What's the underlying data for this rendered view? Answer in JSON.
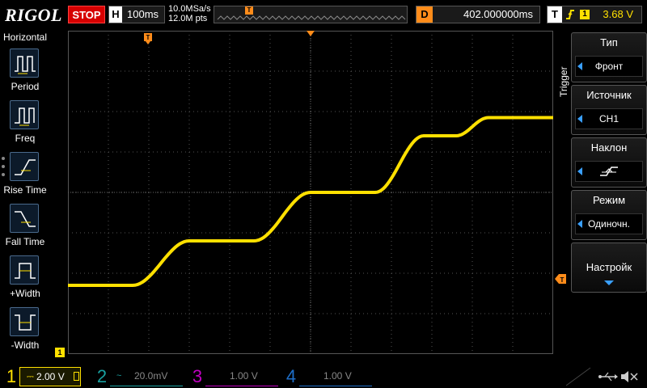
{
  "header": {
    "logo": "RIGOL",
    "run_state": "STOP",
    "horizontal_label": "H",
    "timebase": "100ms",
    "sample_rate": "10.0MSa/s",
    "memory_depth": "12.0M pts",
    "trigger_marker": "T",
    "delay_label": "D",
    "delay_value": "402.000000ms",
    "trigger_label": "T",
    "trigger_source_badge": "1",
    "trigger_level": "3.68 V"
  },
  "left_menu": {
    "title": "Horizontal",
    "items": [
      {
        "label": "Period",
        "icon": "period-icon"
      },
      {
        "label": "Freq",
        "icon": "frequency-icon"
      },
      {
        "label": "Rise Time",
        "icon": "rise-time-icon"
      },
      {
        "label": "Fall Time",
        "icon": "fall-time-icon"
      },
      {
        "label": "+Width",
        "icon": "positive-width-icon"
      },
      {
        "label": "-Width",
        "icon": "negative-width-icon"
      }
    ]
  },
  "right_menu": {
    "title": "Trigger",
    "buttons": [
      {
        "heading": "Тип",
        "value": "Фронт"
      },
      {
        "heading": "Источник",
        "value": "CH1"
      },
      {
        "heading": "Наклон",
        "value": "rising-edge-icon"
      },
      {
        "heading": "Режим",
        "value": "Одиночн."
      },
      {
        "heading": "Настройк"
      }
    ]
  },
  "screen": {
    "trigger_position_marker": "T",
    "ch1_ground_marker": "1",
    "trace_color": "#ffe000"
  },
  "channels": [
    {
      "number": "1",
      "coupling": "⎓",
      "scale": "2.00 V",
      "color": "#ffe000",
      "active": true
    },
    {
      "number": "2",
      "coupling": "~",
      "scale": "20.0mV",
      "color": "#19a0a0",
      "active": false
    },
    {
      "number": "3",
      "coupling": "",
      "scale": "1.00 V",
      "color": "#c000c0",
      "active": false
    },
    {
      "number": "4",
      "coupling": "",
      "scale": "1.00 V",
      "color": "#1e6ec8",
      "active": false
    }
  ],
  "bottom_icons": [
    "usb-icon",
    "mute-icon"
  ],
  "colors": {
    "ch1": "#ffe000",
    "stop": "#d60000",
    "trigger": "#ff8c1a",
    "menu_accent": "#3aa0ff"
  },
  "waveform": {
    "volts_per_div": 2.0,
    "x_ms": [
      0,
      80,
      150,
      230,
      300,
      380,
      440,
      480,
      520,
      600
    ],
    "y_v": [
      -4.6,
      -4.6,
      -2.4,
      -2.4,
      0.0,
      0.0,
      2.8,
      2.8,
      3.7,
      3.7
    ]
  }
}
